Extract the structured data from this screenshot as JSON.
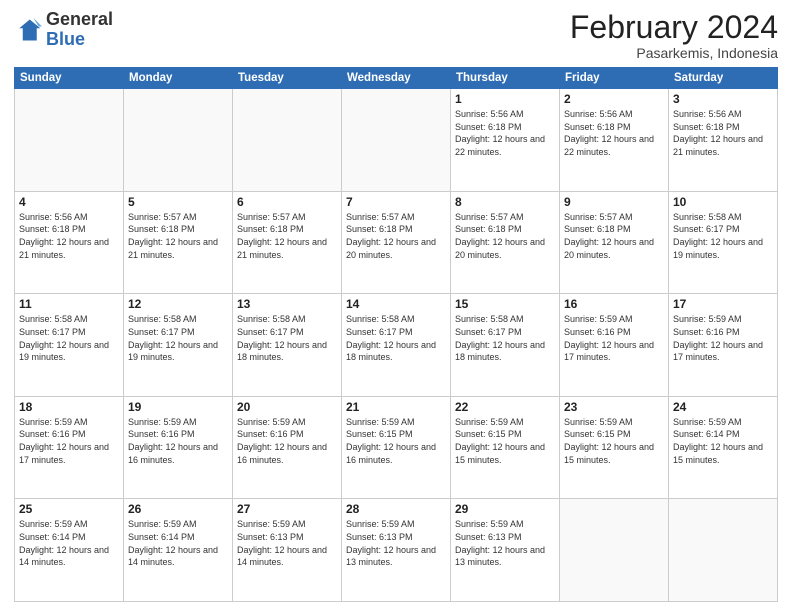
{
  "header": {
    "logo_general": "General",
    "logo_blue": "Blue",
    "title": "February 2024",
    "subtitle": "Pasarkemis, Indonesia"
  },
  "days_of_week": [
    "Sunday",
    "Monday",
    "Tuesday",
    "Wednesday",
    "Thursday",
    "Friday",
    "Saturday"
  ],
  "weeks": [
    [
      {
        "day": "",
        "info": ""
      },
      {
        "day": "",
        "info": ""
      },
      {
        "day": "",
        "info": ""
      },
      {
        "day": "",
        "info": ""
      },
      {
        "day": "1",
        "info": "Sunrise: 5:56 AM\nSunset: 6:18 PM\nDaylight: 12 hours\nand 22 minutes."
      },
      {
        "day": "2",
        "info": "Sunrise: 5:56 AM\nSunset: 6:18 PM\nDaylight: 12 hours\nand 22 minutes."
      },
      {
        "day": "3",
        "info": "Sunrise: 5:56 AM\nSunset: 6:18 PM\nDaylight: 12 hours\nand 21 minutes."
      }
    ],
    [
      {
        "day": "4",
        "info": "Sunrise: 5:56 AM\nSunset: 6:18 PM\nDaylight: 12 hours\nand 21 minutes."
      },
      {
        "day": "5",
        "info": "Sunrise: 5:57 AM\nSunset: 6:18 PM\nDaylight: 12 hours\nand 21 minutes."
      },
      {
        "day": "6",
        "info": "Sunrise: 5:57 AM\nSunset: 6:18 PM\nDaylight: 12 hours\nand 21 minutes."
      },
      {
        "day": "7",
        "info": "Sunrise: 5:57 AM\nSunset: 6:18 PM\nDaylight: 12 hours\nand 20 minutes."
      },
      {
        "day": "8",
        "info": "Sunrise: 5:57 AM\nSunset: 6:18 PM\nDaylight: 12 hours\nand 20 minutes."
      },
      {
        "day": "9",
        "info": "Sunrise: 5:57 AM\nSunset: 6:18 PM\nDaylight: 12 hours\nand 20 minutes."
      },
      {
        "day": "10",
        "info": "Sunrise: 5:58 AM\nSunset: 6:17 PM\nDaylight: 12 hours\nand 19 minutes."
      }
    ],
    [
      {
        "day": "11",
        "info": "Sunrise: 5:58 AM\nSunset: 6:17 PM\nDaylight: 12 hours\nand 19 minutes."
      },
      {
        "day": "12",
        "info": "Sunrise: 5:58 AM\nSunset: 6:17 PM\nDaylight: 12 hours\nand 19 minutes."
      },
      {
        "day": "13",
        "info": "Sunrise: 5:58 AM\nSunset: 6:17 PM\nDaylight: 12 hours\nand 18 minutes."
      },
      {
        "day": "14",
        "info": "Sunrise: 5:58 AM\nSunset: 6:17 PM\nDaylight: 12 hours\nand 18 minutes."
      },
      {
        "day": "15",
        "info": "Sunrise: 5:58 AM\nSunset: 6:17 PM\nDaylight: 12 hours\nand 18 minutes."
      },
      {
        "day": "16",
        "info": "Sunrise: 5:59 AM\nSunset: 6:16 PM\nDaylight: 12 hours\nand 17 minutes."
      },
      {
        "day": "17",
        "info": "Sunrise: 5:59 AM\nSunset: 6:16 PM\nDaylight: 12 hours\nand 17 minutes."
      }
    ],
    [
      {
        "day": "18",
        "info": "Sunrise: 5:59 AM\nSunset: 6:16 PM\nDaylight: 12 hours\nand 17 minutes."
      },
      {
        "day": "19",
        "info": "Sunrise: 5:59 AM\nSunset: 6:16 PM\nDaylight: 12 hours\nand 16 minutes."
      },
      {
        "day": "20",
        "info": "Sunrise: 5:59 AM\nSunset: 6:16 PM\nDaylight: 12 hours\nand 16 minutes."
      },
      {
        "day": "21",
        "info": "Sunrise: 5:59 AM\nSunset: 6:15 PM\nDaylight: 12 hours\nand 16 minutes."
      },
      {
        "day": "22",
        "info": "Sunrise: 5:59 AM\nSunset: 6:15 PM\nDaylight: 12 hours\nand 15 minutes."
      },
      {
        "day": "23",
        "info": "Sunrise: 5:59 AM\nSunset: 6:15 PM\nDaylight: 12 hours\nand 15 minutes."
      },
      {
        "day": "24",
        "info": "Sunrise: 5:59 AM\nSunset: 6:14 PM\nDaylight: 12 hours\nand 15 minutes."
      }
    ],
    [
      {
        "day": "25",
        "info": "Sunrise: 5:59 AM\nSunset: 6:14 PM\nDaylight: 12 hours\nand 14 minutes."
      },
      {
        "day": "26",
        "info": "Sunrise: 5:59 AM\nSunset: 6:14 PM\nDaylight: 12 hours\nand 14 minutes."
      },
      {
        "day": "27",
        "info": "Sunrise: 5:59 AM\nSunset: 6:13 PM\nDaylight: 12 hours\nand 14 minutes."
      },
      {
        "day": "28",
        "info": "Sunrise: 5:59 AM\nSunset: 6:13 PM\nDaylight: 12 hours\nand 13 minutes."
      },
      {
        "day": "29",
        "info": "Sunrise: 5:59 AM\nSunset: 6:13 PM\nDaylight: 12 hours\nand 13 minutes."
      },
      {
        "day": "",
        "info": ""
      },
      {
        "day": "",
        "info": ""
      }
    ]
  ]
}
